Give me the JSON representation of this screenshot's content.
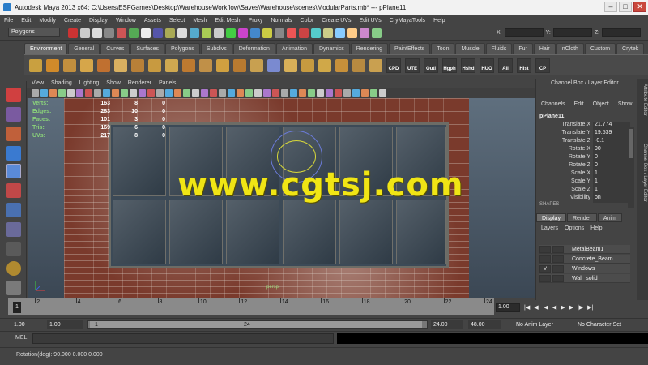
{
  "titlebar": {
    "title": "Autodesk Maya 2013 x64: C:\\Users\\ESFGames\\Desktop\\WarehouseWorkflow\\Saves\\Warehouse\\scenes\\ModularParts.mb* --- pPlane11"
  },
  "menu": [
    "File",
    "Edit",
    "Modify",
    "Create",
    "Display",
    "Window",
    "Assets",
    "Select",
    "Mesh",
    "Edit Mesh",
    "Proxy",
    "Normals",
    "Color",
    "Create UVs",
    "Edit UVs",
    "CryMayaTools",
    "Help"
  ],
  "status": {
    "mode": "Polygons",
    "x_label": "X:",
    "y_label": "Y:",
    "z_label": "Z:"
  },
  "shelf_tabs": [
    "Environment",
    "General",
    "Curves",
    "Surfaces",
    "Polygons",
    "Subdivs",
    "Deformation",
    "Animation",
    "Dynamics",
    "Rendering",
    "PaintEffects",
    "Toon",
    "Muscle",
    "Fluids",
    "Fur",
    "Hair",
    "nCloth",
    "Custom",
    "Crytek"
  ],
  "shelf_labels": [
    "CPD",
    "UTE",
    "Outl",
    "Hgph",
    "Hshd",
    "HUO",
    "All",
    "Hist",
    "CP"
  ],
  "panel_menu": [
    "View",
    "Shading",
    "Lighting",
    "Show",
    "Renderer",
    "Panels"
  ],
  "hud": {
    "rows": [
      {
        "k": "Verts:",
        "a": "163",
        "b": "8",
        "c": "0"
      },
      {
        "k": "Edges:",
        "a": "283",
        "b": "10",
        "c": "0"
      },
      {
        "k": "Faces:",
        "a": "101",
        "b": "3",
        "c": "0"
      },
      {
        "k": "Tris:",
        "a": "169",
        "b": "6",
        "c": "0"
      },
      {
        "k": "UVs:",
        "a": "217",
        "b": "8",
        "c": "0"
      }
    ]
  },
  "watermark": "www.cgtsj.com",
  "camera_label": "persp",
  "channel_box": {
    "title": "Channel Box / Layer Editor",
    "menu": [
      "Channels",
      "Edit",
      "Object",
      "Show"
    ],
    "node": "pPlane11",
    "attrs": [
      {
        "n": "Translate X",
        "v": "21.774"
      },
      {
        "n": "Translate Y",
        "v": "19.539"
      },
      {
        "n": "Translate Z",
        "v": "-0.1"
      },
      {
        "n": "Rotate X",
        "v": "90"
      },
      {
        "n": "Rotate Y",
        "v": "0"
      },
      {
        "n": "Rotate Z",
        "v": "0"
      },
      {
        "n": "Scale X",
        "v": "1"
      },
      {
        "n": "Scale Y",
        "v": "1"
      },
      {
        "n": "Scale Z",
        "v": "1"
      },
      {
        "n": "Visibility",
        "v": "on"
      }
    ],
    "shapes_label": "SHAPES"
  },
  "layer_editor": {
    "tabs": [
      "Display",
      "Render",
      "Anim"
    ],
    "menu": [
      "Layers",
      "Options",
      "Help"
    ],
    "layers": [
      {
        "v": "",
        "name": "MetalBeam1"
      },
      {
        "v": "",
        "name": "Concrete_Beam"
      },
      {
        "v": "V",
        "name": "Windows"
      },
      {
        "v": "",
        "name": "Wall_solid"
      }
    ]
  },
  "side_tabs": [
    "Attribute Editor",
    "Channel Box / Layer Editor"
  ],
  "timeline": {
    "ticks": [
      "1",
      "2",
      "4",
      "6",
      "8",
      "10",
      "12",
      "14",
      "16",
      "18",
      "20",
      "22",
      "24"
    ],
    "current": "1.00",
    "current_frame_label": "1"
  },
  "range": {
    "start": "1.00",
    "start2": "1.00",
    "inner_start": "1",
    "inner_end": "24",
    "end": "24.00",
    "end2": "48.00",
    "anim_layer": "No Anim Layer",
    "char_set": "No Character Set"
  },
  "command": {
    "label": "MEL"
  },
  "help_line": {
    "text": "Rotation(deg):   90.000     0.000     0.000"
  }
}
